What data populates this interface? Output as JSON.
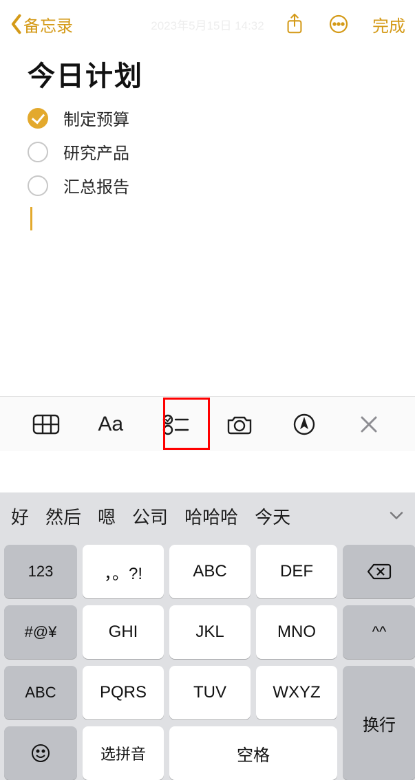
{
  "nav": {
    "back_label": "备忘录",
    "date_text": "2023年5月15日 14:32",
    "done_label": "完成"
  },
  "note": {
    "title": "今日计划",
    "items": [
      {
        "label": "制定预算",
        "checked": true
      },
      {
        "label": "研究产品",
        "checked": false
      },
      {
        "label": "汇总报告",
        "checked": false
      }
    ]
  },
  "toolbar": {
    "text_style_label": "Aa"
  },
  "candidates": {
    "items": [
      "好",
      "然后",
      "嗯",
      "公司",
      "哈哈哈",
      "今天"
    ]
  },
  "keyboard": {
    "k123": "123",
    "punct": "，。?!",
    "abc": "ABC",
    "def": "DEF",
    "hash": "#@¥",
    "ghi": "GHI",
    "jkl": "JKL",
    "mno": "MNO",
    "emote": "^^",
    "abc2": "ABC",
    "pqrs": "PQRS",
    "tuv": "TUV",
    "wxyz": "WXYZ",
    "enter": "换行",
    "select_pinyin": "选拼音",
    "space": "空格"
  }
}
